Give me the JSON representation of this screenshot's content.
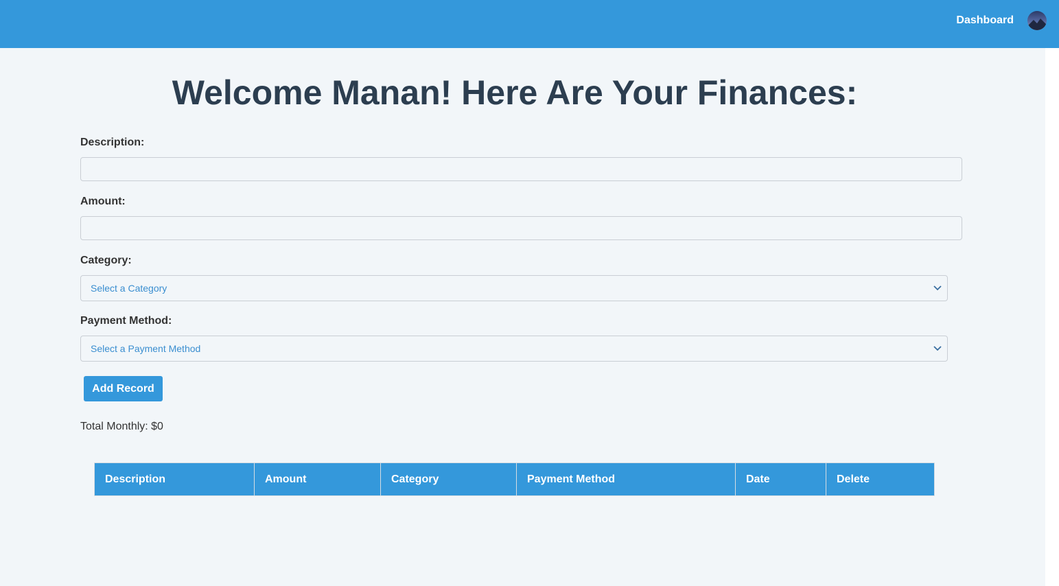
{
  "navbar": {
    "dashboard_label": "Dashboard",
    "avatar_icon": "user-avatar-mountain"
  },
  "page": {
    "title": "Welcome Manan! Here Are Your Finances:"
  },
  "form": {
    "description_label": "Description:",
    "description_value": "",
    "amount_label": "Amount:",
    "amount_value": "",
    "category_label": "Category:",
    "category_selected": "Select a Category",
    "payment_label": "Payment Method:",
    "payment_selected": "Select a Payment Method",
    "add_button": "Add Record"
  },
  "summary": {
    "total_monthly": "Total Monthly: $0"
  },
  "table": {
    "headers": [
      "Description",
      "Amount",
      "Category",
      "Payment Method",
      "Date",
      "Delete"
    ],
    "rows": []
  },
  "colors": {
    "primary": "#3498db",
    "background": "#f2f6f9",
    "title": "#2c3e50",
    "select_text": "#3a8ed0"
  }
}
